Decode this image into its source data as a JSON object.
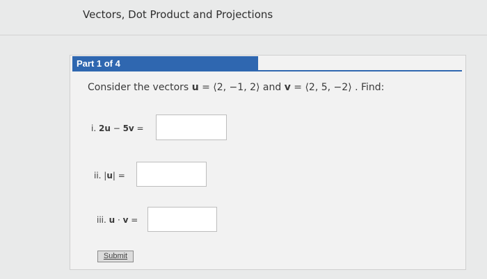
{
  "page": {
    "title": "Vectors, Dot Product and Projections"
  },
  "part": {
    "label": "Part 1 of 4"
  },
  "prompt": {
    "prefix": "Consider the vectors ",
    "u_var": "u",
    "u_value": " = ⟨2, −1, 2⟩ and ",
    "v_var": "v",
    "v_value": " = ⟨2, 5, −2⟩ . Find:"
  },
  "items": [
    {
      "num": "i. ",
      "expr_bold": "2u",
      "expr_mid": " − ",
      "expr_bold2": "5v",
      "eq": " =",
      "value": ""
    },
    {
      "num": "ii. ",
      "expr_pre": "|",
      "expr_bold": "u",
      "expr_post": "|",
      "eq": " =",
      "value": ""
    },
    {
      "num": "iii. ",
      "expr_bold": "u",
      "expr_mid": " · ",
      "expr_bold2": "v",
      "eq": " =",
      "value": ""
    }
  ],
  "submit": {
    "label": "Submit"
  }
}
